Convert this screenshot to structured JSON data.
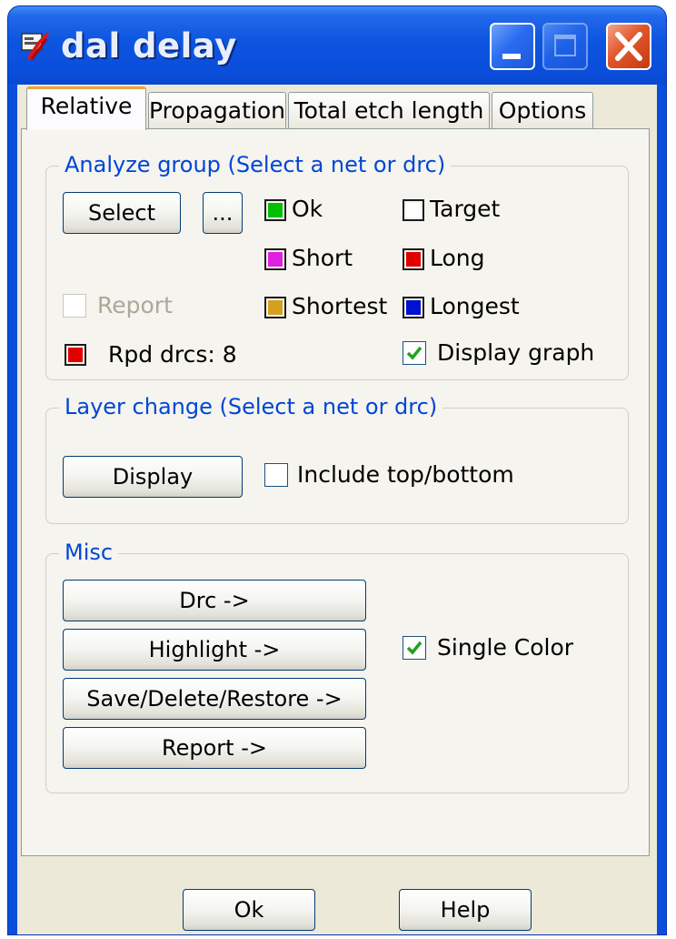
{
  "window": {
    "title": "dal delay"
  },
  "tabs": [
    {
      "label": "Relative",
      "active": true
    },
    {
      "label": "Propagation",
      "active": false
    },
    {
      "label": "Total etch length",
      "active": false
    },
    {
      "label": "Options",
      "active": false
    }
  ],
  "analyze_group": {
    "title": "Analyze group (Select a net or drc)",
    "select_label": "Select",
    "browse_label": "...",
    "legend": [
      {
        "label": "Ok",
        "color": "#00c000"
      },
      {
        "label": "Target",
        "color": "#ffffff"
      },
      {
        "label": "Short",
        "color": "#e020e0"
      },
      {
        "label": "Long",
        "color": "#e00000"
      },
      {
        "label": "Shortest",
        "color": "#d4a020"
      },
      {
        "label": "Longest",
        "color": "#0010d0"
      }
    ],
    "report_label": "Report",
    "report_checked": false,
    "rpd_drcs_label": "Rpd drcs: 8",
    "rpd_drcs_color": "#e00000",
    "display_graph_label": "Display graph",
    "display_graph_checked": true
  },
  "layer_change": {
    "title": "Layer change (Select a net or drc)",
    "display_label": "Display",
    "include_label": "Include top/bottom",
    "include_checked": false
  },
  "misc": {
    "title": "Misc",
    "buttons": [
      {
        "label": "Drc ->"
      },
      {
        "label": "Highlight ->"
      },
      {
        "label": "Save/Delete/Restore ->"
      },
      {
        "label": "Report ->"
      }
    ],
    "single_color_label": "Single Color",
    "single_color_checked": true
  },
  "footer": {
    "ok_label": "Ok",
    "help_label": "Help"
  },
  "colors": {
    "accent": "#0a4fdc",
    "group_title": "#0046d5",
    "tab_highlight": "#f3a43b"
  }
}
